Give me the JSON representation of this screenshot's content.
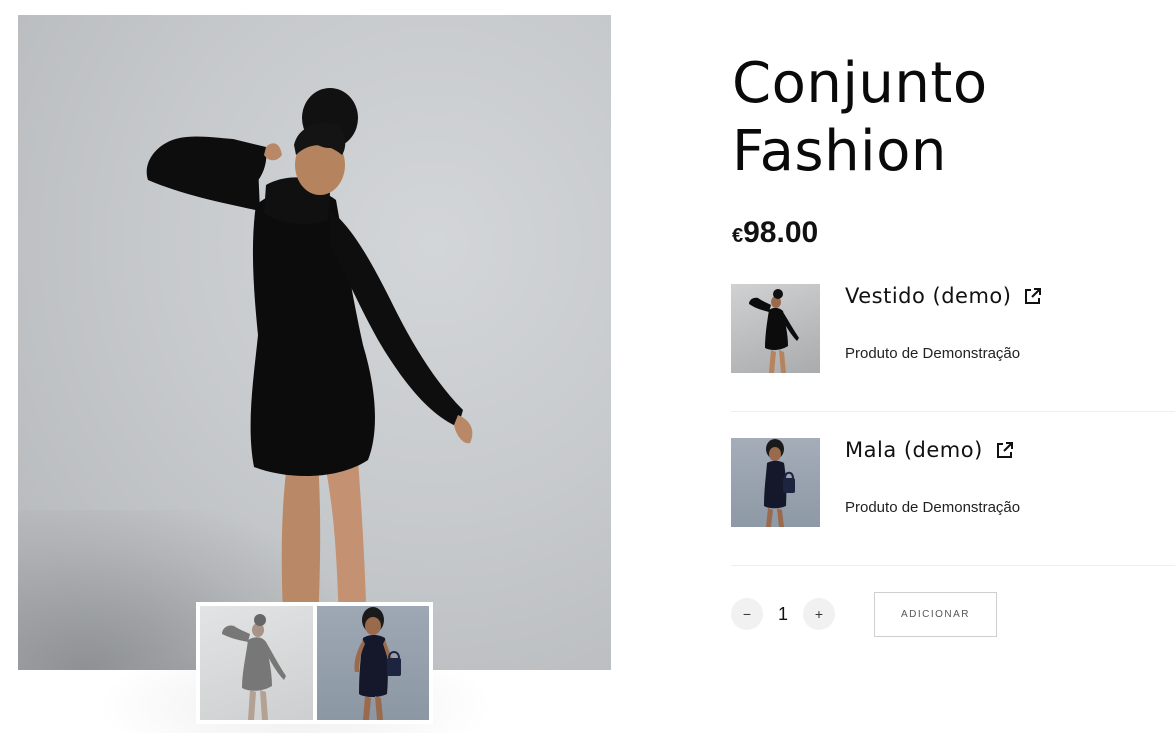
{
  "product": {
    "title_line1": "Conjunto",
    "title_line2": "Fashion",
    "currency": "€",
    "price": "98.00"
  },
  "gallery": {
    "main_image": "woman-black-turtleneck-dress-photo",
    "thumbnails": [
      "woman-black-dress-photo",
      "woman-navy-dress-handbag-photo"
    ]
  },
  "bundle": {
    "items": [
      {
        "name": "Vestido (demo)",
        "description": "Produto de Demonstração",
        "icon": "external-link-icon"
      },
      {
        "name": "Mala (demo)",
        "description": "Produto de Demonstração",
        "icon": "external-link-icon"
      }
    ]
  },
  "cart": {
    "minus_label": "−",
    "quantity": "1",
    "plus_label": "+",
    "add_label": "ADICIONAR"
  },
  "colors": {
    "text": "#111111",
    "background": "#ffffff",
    "divider": "#eeeeee",
    "qty_button_bg": "#f1f1f1"
  }
}
